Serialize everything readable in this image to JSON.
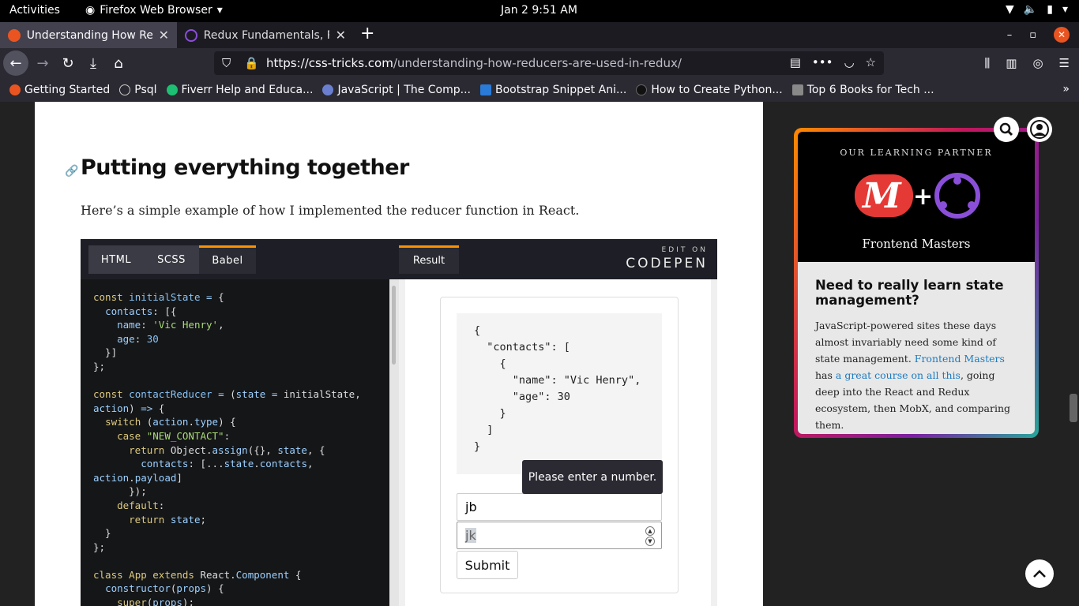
{
  "system": {
    "activities": "Activities",
    "app_name": "Firefox Web Browser",
    "clock": "Jan 2   9:51 AM"
  },
  "tabs": [
    {
      "title": "Understanding How Red",
      "active": true
    },
    {
      "title": "Redux Fundamentals, Pa",
      "active": false
    }
  ],
  "urlbar": {
    "host": "https://css-tricks.com",
    "path": "/understanding-how-reducers-are-used-in-redux/"
  },
  "bookmarks": [
    {
      "label": "Getting Started"
    },
    {
      "label": "Psql"
    },
    {
      "label": "Fiverr Help and Educa..."
    },
    {
      "label": "JavaScript | The Comp..."
    },
    {
      "label": "Bootstrap Snippet Ani..."
    },
    {
      "label": "How to Create Python..."
    },
    {
      "label": "Top 6 Books for Tech ..."
    }
  ],
  "article": {
    "heading": "Putting everything together",
    "intro": "Here’s a simple example of how I implemented the reducer function in React."
  },
  "codepen": {
    "tabs": [
      "HTML",
      "SCSS",
      "Babel"
    ],
    "result_tab": "Result",
    "edit_on": "EDIT ON",
    "brand": "CODEPEN",
    "result": {
      "name_value": "jb",
      "age_value": "jk",
      "submit_label": "Submit",
      "tooltip": "Please enter a number."
    }
  },
  "ad": {
    "partner_label": "OUR LEARNING PARTNER",
    "brand": "Frontend Masters",
    "title": "Need to really learn state management?",
    "body_1": "JavaScript-powered sites these days almost invariably need some kind of state management. ",
    "link_1": "Frontend Masters",
    "body_2": " has ",
    "link_2": "a great course on all this",
    "body_3": ", going deep into the React and Redux ecosystem, then MobX, and comparing them."
  },
  "colors": {
    "accent_orange": "#ff9000",
    "link_blue": "#1a7bc0",
    "firefox_dark": "#2b2a33"
  }
}
